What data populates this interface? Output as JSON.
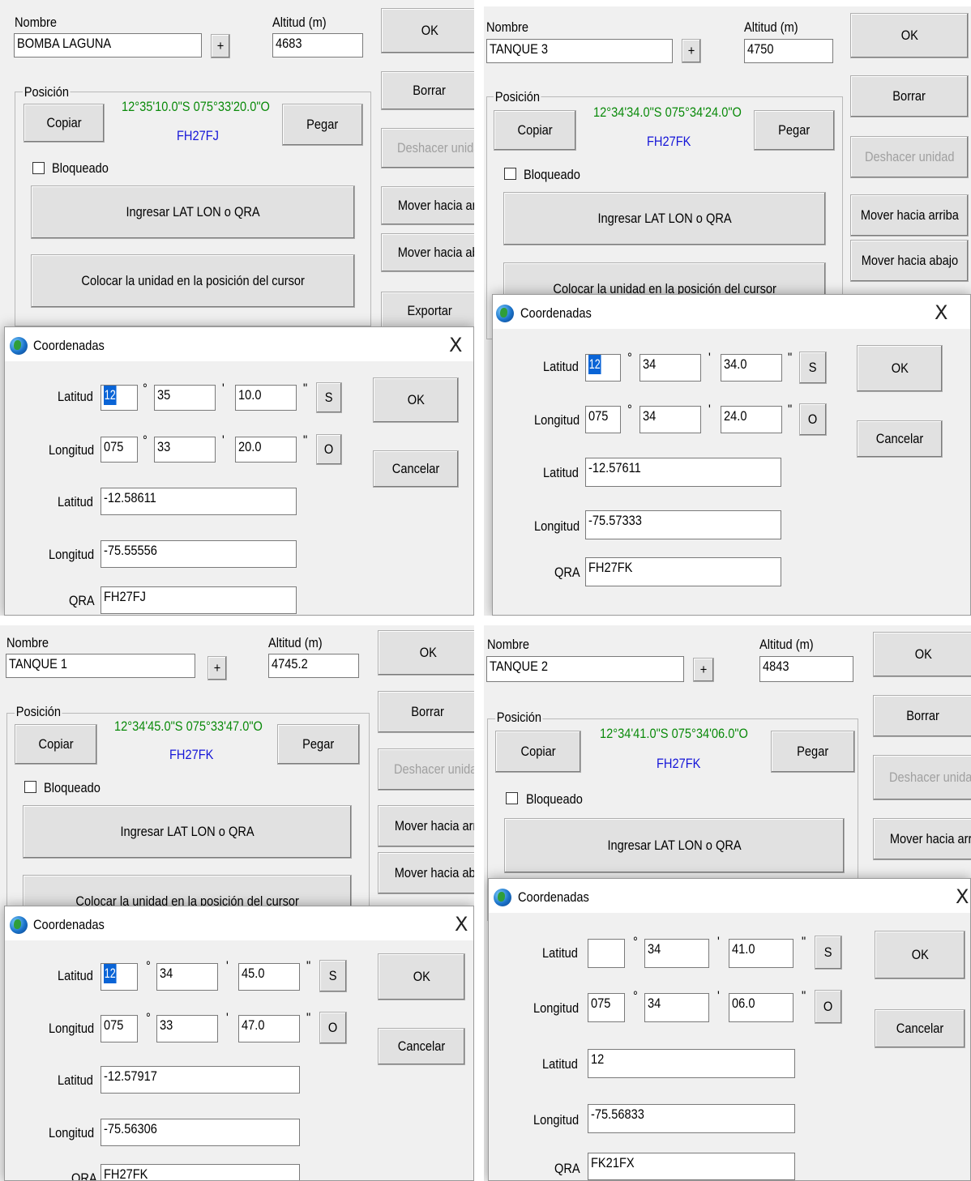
{
  "unit_form": {
    "name_label": "Nombre",
    "altitude_label": "Altitud (m)",
    "plus_label": "+",
    "ok_label": "OK",
    "position_label": "Posición",
    "copy_label": "Copiar",
    "paste_label": "Pegar",
    "locked_label": "Bloqueado",
    "enter_label": "Ingresar LAT LON o QRA",
    "place_label": "Colocar la unidad en la posición del cursor",
    "delete_label": "Borrar",
    "undo_label": "Deshacer unidad",
    "move_up_label": "Mover hacia arriba",
    "move_down_label": "Mover hacia abajo",
    "export_label": "Exportar"
  },
  "dialog": {
    "title": "Coordenadas",
    "close_glyph": "X",
    "lat_label": "Latitud",
    "lon_label": "Longitud",
    "qra_label": "QRA",
    "degree_mark": "°",
    "minute_mark": "'",
    "second_mark": "\"",
    "ok_label": "OK",
    "cancel_label": "Cancelar"
  },
  "panels": [
    {
      "name": "BOMBA LAGUNA",
      "altitude": "4683",
      "coords_text": "12°35'10.0\"S 075°33'20.0\"O",
      "grid": "FH27FJ",
      "lat_deg": "12",
      "lat_min": "35",
      "lat_sec": "10.0",
      "lat_hemi": "S",
      "lon_deg": "075",
      "lon_min": "33",
      "lon_sec": "20.0",
      "lon_hemi": "O",
      "lat_dec": "-12.58611",
      "lon_dec": "-75.55556",
      "qra": "FH27FJ"
    },
    {
      "name": "TANQUE 3",
      "altitude": "4750",
      "coords_text": "12°34'34.0\"S 075°34'24.0\"O",
      "grid": "FH27FK",
      "lat_deg": "12",
      "lat_min": "34",
      "lat_sec": "34.0",
      "lat_hemi": "S",
      "lon_deg": "075",
      "lon_min": "34",
      "lon_sec": "24.0",
      "lon_hemi": "O",
      "lat_dec": "-12.57611",
      "lon_dec": "-75.57333",
      "qra": "FH27FK"
    },
    {
      "name": "TANQUE 1",
      "altitude": "4745.2",
      "coords_text": "12°34'45.0\"S 075°33'47.0\"O",
      "grid": "FH27FK",
      "lat_deg": "12",
      "lat_min": "34",
      "lat_sec": "45.0",
      "lat_hemi": "S",
      "lon_deg": "075",
      "lon_min": "33",
      "lon_sec": "47.0",
      "lon_hemi": "O",
      "lat_dec": "-12.57917",
      "lon_dec": "-75.56306",
      "qra": "FH27FK"
    },
    {
      "name": "TANQUE 2",
      "altitude": "4843",
      "coords_text": "12°34'41.0\"S 075°34'06.0\"O",
      "grid": "FH27FK",
      "lat_deg": "",
      "lat_min": "34",
      "lat_sec": "41.0",
      "lat_hemi": "S",
      "lon_deg": "075",
      "lon_min": "34",
      "lon_sec": "06.0",
      "lon_hemi": "O",
      "lat_dec": "12",
      "lon_dec": "-75.56833",
      "qra": "FK21FX"
    }
  ]
}
